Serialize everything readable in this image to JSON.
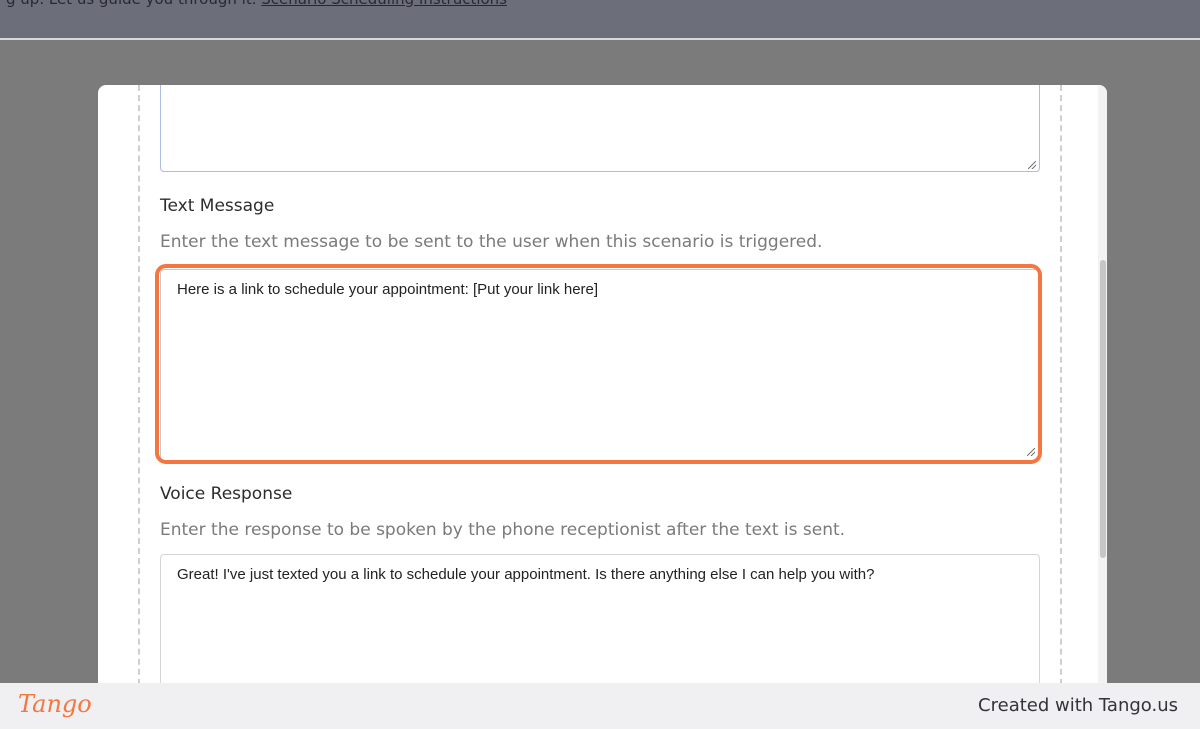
{
  "background_page": {
    "partial_text": "g up. Let us guide you through it.",
    "link_text": "Scenario Scheduling Instructions"
  },
  "form": {
    "previous_field": {
      "value": ""
    },
    "text_message": {
      "label": "Text Message",
      "helper": "Enter the text message to be sent to the user when this scenario is triggered.",
      "value": "Here is a link to schedule your appointment: [Put your link here]"
    },
    "voice_response": {
      "label": "Voice Response",
      "helper": "Enter the response to be spoken by the phone receptionist after the text is sent.",
      "value": "Great! I've just texted you a link to schedule your appointment. Is there anything else I can help you with?"
    }
  },
  "footer": {
    "logo": "Tango",
    "credit": "Created with Tango.us"
  },
  "colors": {
    "highlight": "#f4773f",
    "overlay": "#7b7b7b",
    "logo": "#f4773f"
  }
}
